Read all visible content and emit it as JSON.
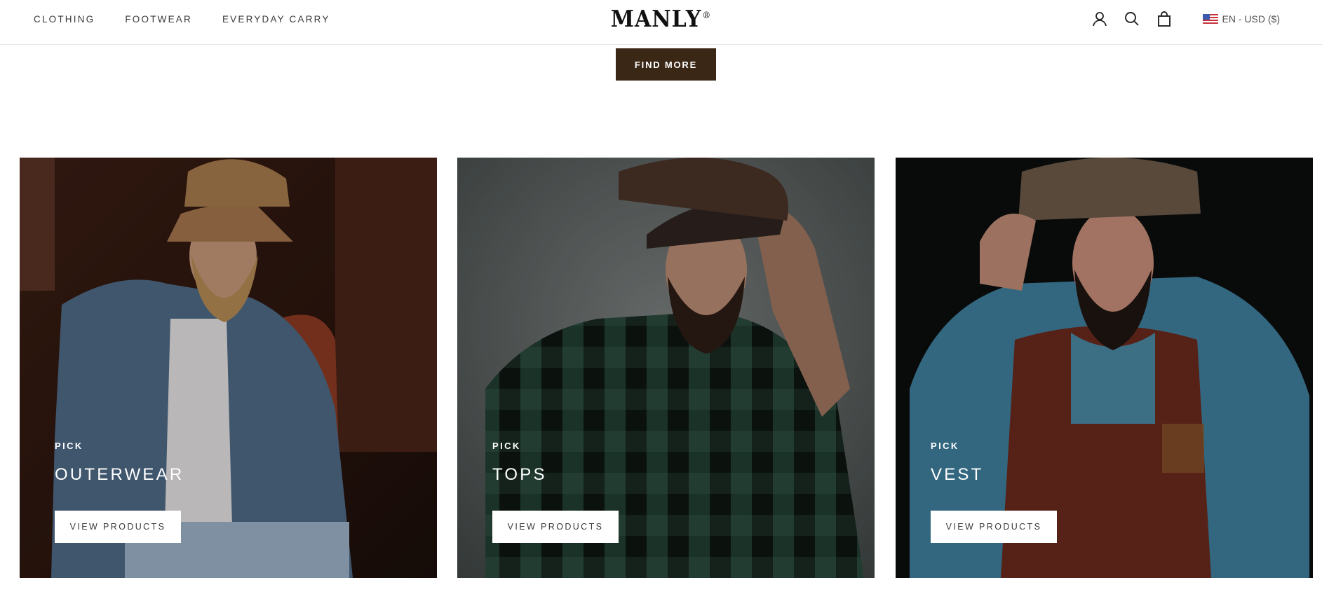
{
  "header": {
    "nav": [
      "CLOTHING",
      "FOOTWEAR",
      "EVERYDAY CARRY"
    ],
    "logo": "MANLY",
    "logo_mark": "®",
    "icons": [
      "account-icon",
      "search-icon",
      "cart-icon"
    ],
    "locale": "EN - USD ($)"
  },
  "hero": {
    "find_more_label": "FIND MORE"
  },
  "cards": [
    {
      "kicker": "PICK",
      "title": "OUTERWEAR",
      "button": "VIEW PRODUCTS"
    },
    {
      "kicker": "PICK",
      "title": "TOPS",
      "button": "VIEW PRODUCTS"
    },
    {
      "kicker": "PICK",
      "title": "VEST",
      "button": "VIEW PRODUCTS"
    }
  ],
  "colors": {
    "accent": "#3a2716",
    "text": "#1c1b1b",
    "button_text": "#3a3a3a"
  }
}
